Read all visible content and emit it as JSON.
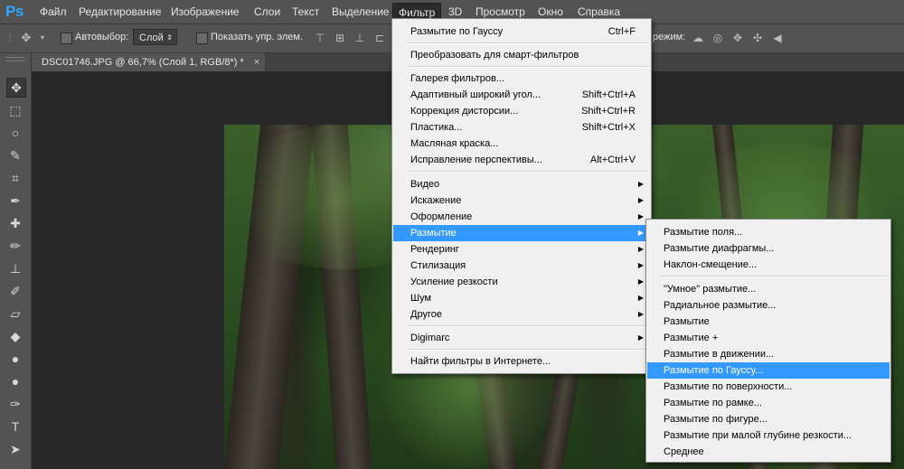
{
  "app": {
    "logo": "Ps"
  },
  "menubar": [
    {
      "label": "Файл"
    },
    {
      "label": "Редактирование"
    },
    {
      "label": "Изображение"
    },
    {
      "label": "Слои"
    },
    {
      "label": "Текст"
    },
    {
      "label": "Выделение"
    },
    {
      "label": "Фильтр"
    },
    {
      "label": "3D"
    },
    {
      "label": "Просмотр"
    },
    {
      "label": "Окно"
    },
    {
      "label": "Справка"
    }
  ],
  "options": {
    "autoselect_label": "Автовыбор:",
    "autoselect_value": "Слой",
    "show_transform_label": "Показать упр. элем.",
    "mode_3d_label": "режим:"
  },
  "document_tab": {
    "title": "DSC01746.JPG @ 66,7% (Слой 1, RGB/8*) *",
    "close": "×"
  },
  "filter_menu": {
    "items": [
      {
        "label": "Размытие по Гауссу",
        "shortcut": "Ctrl+F"
      },
      {
        "label": "Преобразовать для смарт-фильтров",
        "shortcut": ""
      },
      {
        "label": "Галерея фильтров...",
        "shortcut": ""
      },
      {
        "label": "Адаптивный широкий угол...",
        "shortcut": "Shift+Ctrl+A"
      },
      {
        "label": "Коррекция дисторсии...",
        "shortcut": "Shift+Ctrl+R"
      },
      {
        "label": "Пластика...",
        "shortcut": "Shift+Ctrl+X"
      },
      {
        "label": "Масляная краска...",
        "shortcut": ""
      },
      {
        "label": "Исправление перспективы...",
        "shortcut": "Alt+Ctrl+V"
      },
      {
        "label": "Видео",
        "submenu": true
      },
      {
        "label": "Искажение",
        "submenu": true
      },
      {
        "label": "Оформление",
        "submenu": true
      },
      {
        "label": "Размытие",
        "submenu": true,
        "highlighted": true
      },
      {
        "label": "Рендеринг",
        "submenu": true
      },
      {
        "label": "Стилизация",
        "submenu": true
      },
      {
        "label": "Усиление резкости",
        "submenu": true
      },
      {
        "label": "Шум",
        "submenu": true
      },
      {
        "label": "Другое",
        "submenu": true
      },
      {
        "label": "Digimarc",
        "submenu": true
      },
      {
        "label": "Найти фильтры в Интернете...",
        "shortcut": ""
      }
    ]
  },
  "blur_submenu": {
    "items": [
      {
        "label": "Размытие поля..."
      },
      {
        "label": "Размытие диафрагмы..."
      },
      {
        "label": "Наклон-смещение..."
      },
      {
        "label": "\"Умное\" размытие..."
      },
      {
        "label": "Радиальное размытие..."
      },
      {
        "label": "Размытие"
      },
      {
        "label": "Размытие +"
      },
      {
        "label": "Размытие в движении..."
      },
      {
        "label": "Размытие по Гауссу...",
        "highlighted": true
      },
      {
        "label": "Размытие по поверхности..."
      },
      {
        "label": "Размытие по рамке..."
      },
      {
        "label": "Размытие по фигуре..."
      },
      {
        "label": "Размытие при малой глубине резкости..."
      },
      {
        "label": "Среднее"
      }
    ]
  },
  "colors": {
    "highlight": "#3399ff",
    "menu_bg": "#f0f0f0",
    "chrome": "#535353"
  }
}
